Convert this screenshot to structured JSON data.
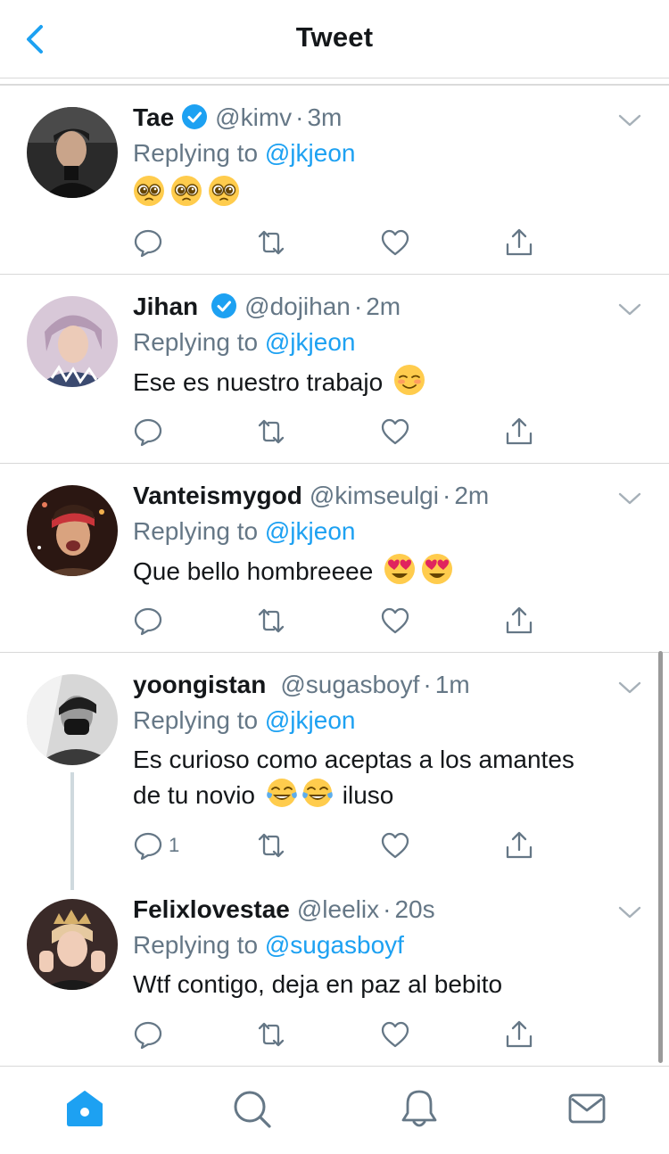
{
  "header": {
    "title": "Tweet",
    "back_icon": "chevron-left-icon"
  },
  "colors": {
    "accent": "#1da1f2",
    "secondary_text": "#657786",
    "text": "#14171a",
    "divider": "#d8d8d8"
  },
  "tweets": [
    {
      "name": "Tae",
      "verified": true,
      "handle": "@kimv",
      "sep": "·",
      "time": "3m",
      "reply_prefix": "Replying to",
      "reply_to": "@jkjeon",
      "text": "",
      "emojis": [
        "pleading-face",
        "pleading-face",
        "pleading-face"
      ],
      "reply_count": ""
    },
    {
      "name": "Jihan",
      "verified": true,
      "handle": "@dojihan",
      "sep": "·",
      "time": "2m",
      "reply_prefix": "Replying to",
      "reply_to": "@jkjeon",
      "text": "Ese es nuestro trabajo",
      "emojis": [
        "smiling-face"
      ],
      "reply_count": ""
    },
    {
      "name": "Vanteismygod",
      "verified": false,
      "handle": "@kimseulgi",
      "sep": "·",
      "time": "2m",
      "reply_prefix": "Replying to",
      "reply_to": "@jkjeon",
      "text": "Que bello hombreeee",
      "emojis": [
        "heart-eyes",
        "heart-eyes"
      ],
      "reply_count": ""
    },
    {
      "name": "yoongistan",
      "verified": false,
      "handle": "@sugasboyf",
      "sep": "·",
      "time": "1m",
      "reply_prefix": "Replying to",
      "reply_to": "@jkjeon",
      "text_line1": "Es curioso como aceptas a los amantes",
      "text_line2_a": "de tu novio",
      "text_line2_b": "iluso",
      "emojis": [
        "tears-of-joy",
        "tears-of-joy"
      ],
      "reply_count": "1"
    },
    {
      "name": "Felixlovestae",
      "verified": false,
      "handle": "@leelix",
      "sep": "·",
      "time": "20s",
      "reply_prefix": "Replying to",
      "reply_to": "@sugasboyf",
      "text": "Wtf contigo, deja en paz al bebito",
      "emojis": [],
      "reply_count": ""
    }
  ],
  "action_icons": [
    "reply-icon",
    "retweet-icon",
    "like-icon",
    "share-icon"
  ],
  "tabbar": {
    "tabs": [
      "home-icon",
      "search-icon",
      "notifications-icon",
      "messages-icon"
    ],
    "active": "home-icon"
  }
}
